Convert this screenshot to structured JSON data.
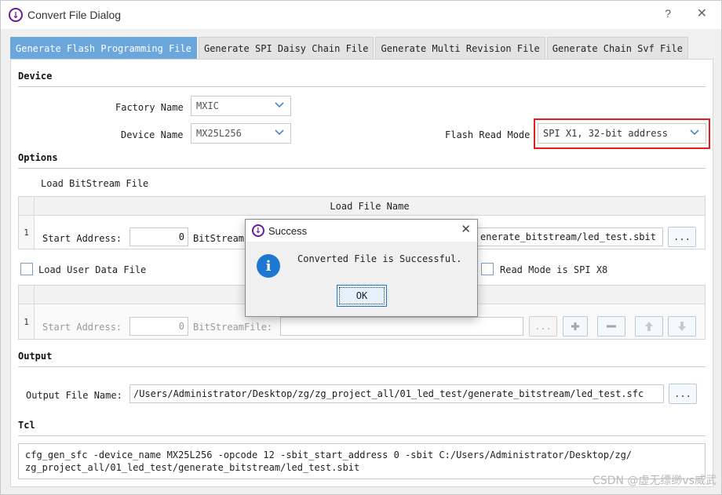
{
  "window": {
    "title": "Convert File Dialog",
    "help_glyph": "?",
    "close_glyph": "✕",
    "icon_glyph": "↓"
  },
  "tabs": [
    {
      "label": "Generate Flash Programming File",
      "active": true
    },
    {
      "label": "Generate SPI Daisy Chain File",
      "active": false
    },
    {
      "label": "Generate Multi Revision File",
      "active": false
    },
    {
      "label": "Generate Chain Svf File",
      "active": false
    }
  ],
  "device": {
    "section_title": "Device",
    "factory_label": "Factory Name",
    "factory_value": "MXIC",
    "device_label": "Device Name",
    "device_value": "MX25L256",
    "flash_mode_label": "Flash Read Mode",
    "flash_mode_value": "SPI X1, 32-bit address"
  },
  "options": {
    "section_title": "Options",
    "load_bitstream_label": "Load BitStream File",
    "table_header": "Load File Name",
    "row1": {
      "num": "1",
      "start_label": "Start Address:",
      "start_value": "0",
      "bitstream_label": "BitStream",
      "path_value": "enerate_bitstream/led_test.sbit",
      "browse_label": "..."
    },
    "load_user_label": "Load User Data File",
    "read_mode_label": "Read Mode is SPI X8",
    "row2": {
      "num": "1",
      "start_label": "Start Address:",
      "start_value": "0",
      "bitstream_label": "BitStreamFile:",
      "path_value": "",
      "browse_label": "..."
    }
  },
  "output": {
    "section_title": "Output",
    "name_label": "Output File Name:",
    "name_value": "/Users/Administrator/Desktop/zg/zg_project_all/01_led_test/generate_bitstream/led_test.sfc",
    "browse_label": "..."
  },
  "tcl": {
    "section_title": "Tcl",
    "line1": "cfg_gen_sfc -device_name MX25L256 -opcode 12 -sbit_start_address 0 -sbit C:/Users/Administrator/Desktop/zg/",
    "line2": "zg_project_all/01_led_test/generate_bitstream/led_test.sbit"
  },
  "modal": {
    "title": "Success",
    "close_glyph": "✕",
    "info_glyph": "i",
    "message": "Converted File is Successful.",
    "ok_label": "OK"
  },
  "watermark": "CSDN @虚无缥缈vs威武",
  "colors": {
    "tab_active": "#6ba7dc",
    "highlight": "#e0201a",
    "info_icon": "#1e78d2",
    "app_icon": "#6a1b9a"
  }
}
